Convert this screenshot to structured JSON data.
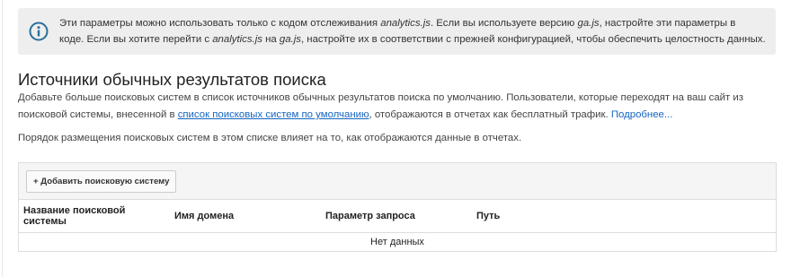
{
  "info_banner": {
    "icon": "info-icon",
    "line1_a": "Эти параметры можно использовать только с кодом отслеживания ",
    "line1_b": "analytics.js",
    "line1_c": ". Если вы используете версию ",
    "line1_d": "ga.js",
    "line1_e": ", настройте эти параметры в",
    "line2_a": "коде. Если вы хотите перейти с ",
    "line2_b": "analytics.js",
    "line2_c": " на ",
    "line2_d": "ga.js",
    "line2_e": ", настройте их в соответствии с прежней конфигурацией, чтобы обеспечить целостность данных."
  },
  "section": {
    "title": "Источники обычных результатов поиска",
    "desc_a": "Добавьте больше поисковых систем в список источников обычных результатов поиска по умолчанию. Пользователи, которые переходят на ваш сайт из",
    "desc_b": "поисковой системы, внесенной в ",
    "desc_link": "список поисковых систем по умолчанию",
    "desc_c": ", отображаются в отчетах как бесплатный трафик. ",
    "desc_more": "Подробнее...",
    "order_note": "Порядок размещения поисковых систем в этом списке влияет на то, как отображаются данные в отчетах."
  },
  "table": {
    "add_button_label": "+ Добавить поисковую систему",
    "columns": {
      "name_line1": "Название поисковой",
      "name_line2": "системы",
      "domain": "Имя домена",
      "param": "Параметр запроса",
      "path": "Путь"
    },
    "empty_text": "Нет данных"
  },
  "colors": {
    "banner_bg": "#eeeeee",
    "info_icon": "#2a6f9b",
    "link": "#1565c0"
  }
}
